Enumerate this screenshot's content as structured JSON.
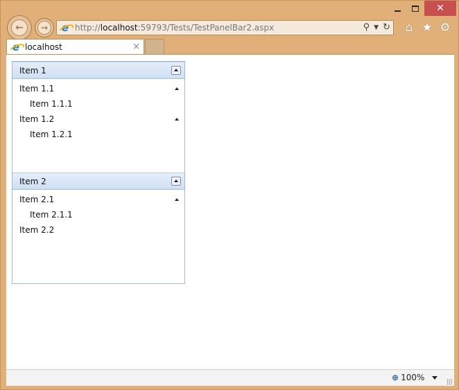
{
  "browser": {
    "address_protocol": "http://",
    "address_host": "localhost",
    "address_rest": ":59793/Tests/TestPanelBar2.aspx",
    "tab_title": "localhost",
    "tab_close": "×",
    "zoom": "100%",
    "icons": {
      "back": "arrow-left-icon",
      "forward": "arrow-right-icon",
      "search": "search-icon",
      "refresh": "refresh-icon",
      "home": "home-icon",
      "favorites": "star-icon",
      "tools": "gear-icon"
    }
  },
  "panelbar": {
    "groups": [
      {
        "label": "Item 1",
        "items": [
          {
            "label": "Item 1.1",
            "children": [
              "Item 1.1.1"
            ]
          },
          {
            "label": "Item 1.2",
            "children": [
              "Item 1.2.1"
            ]
          }
        ]
      },
      {
        "label": "Item 2",
        "items": [
          {
            "label": "Item 2.1",
            "children": [
              "Item 2.1.1"
            ]
          },
          {
            "label": "Item 2.2",
            "children": []
          }
        ]
      }
    ]
  },
  "colors": {
    "frame": "#e0b078",
    "close_button": "#c7504f",
    "panel_header": "#d7e4f4",
    "panel_border": "#a7b8cc"
  }
}
